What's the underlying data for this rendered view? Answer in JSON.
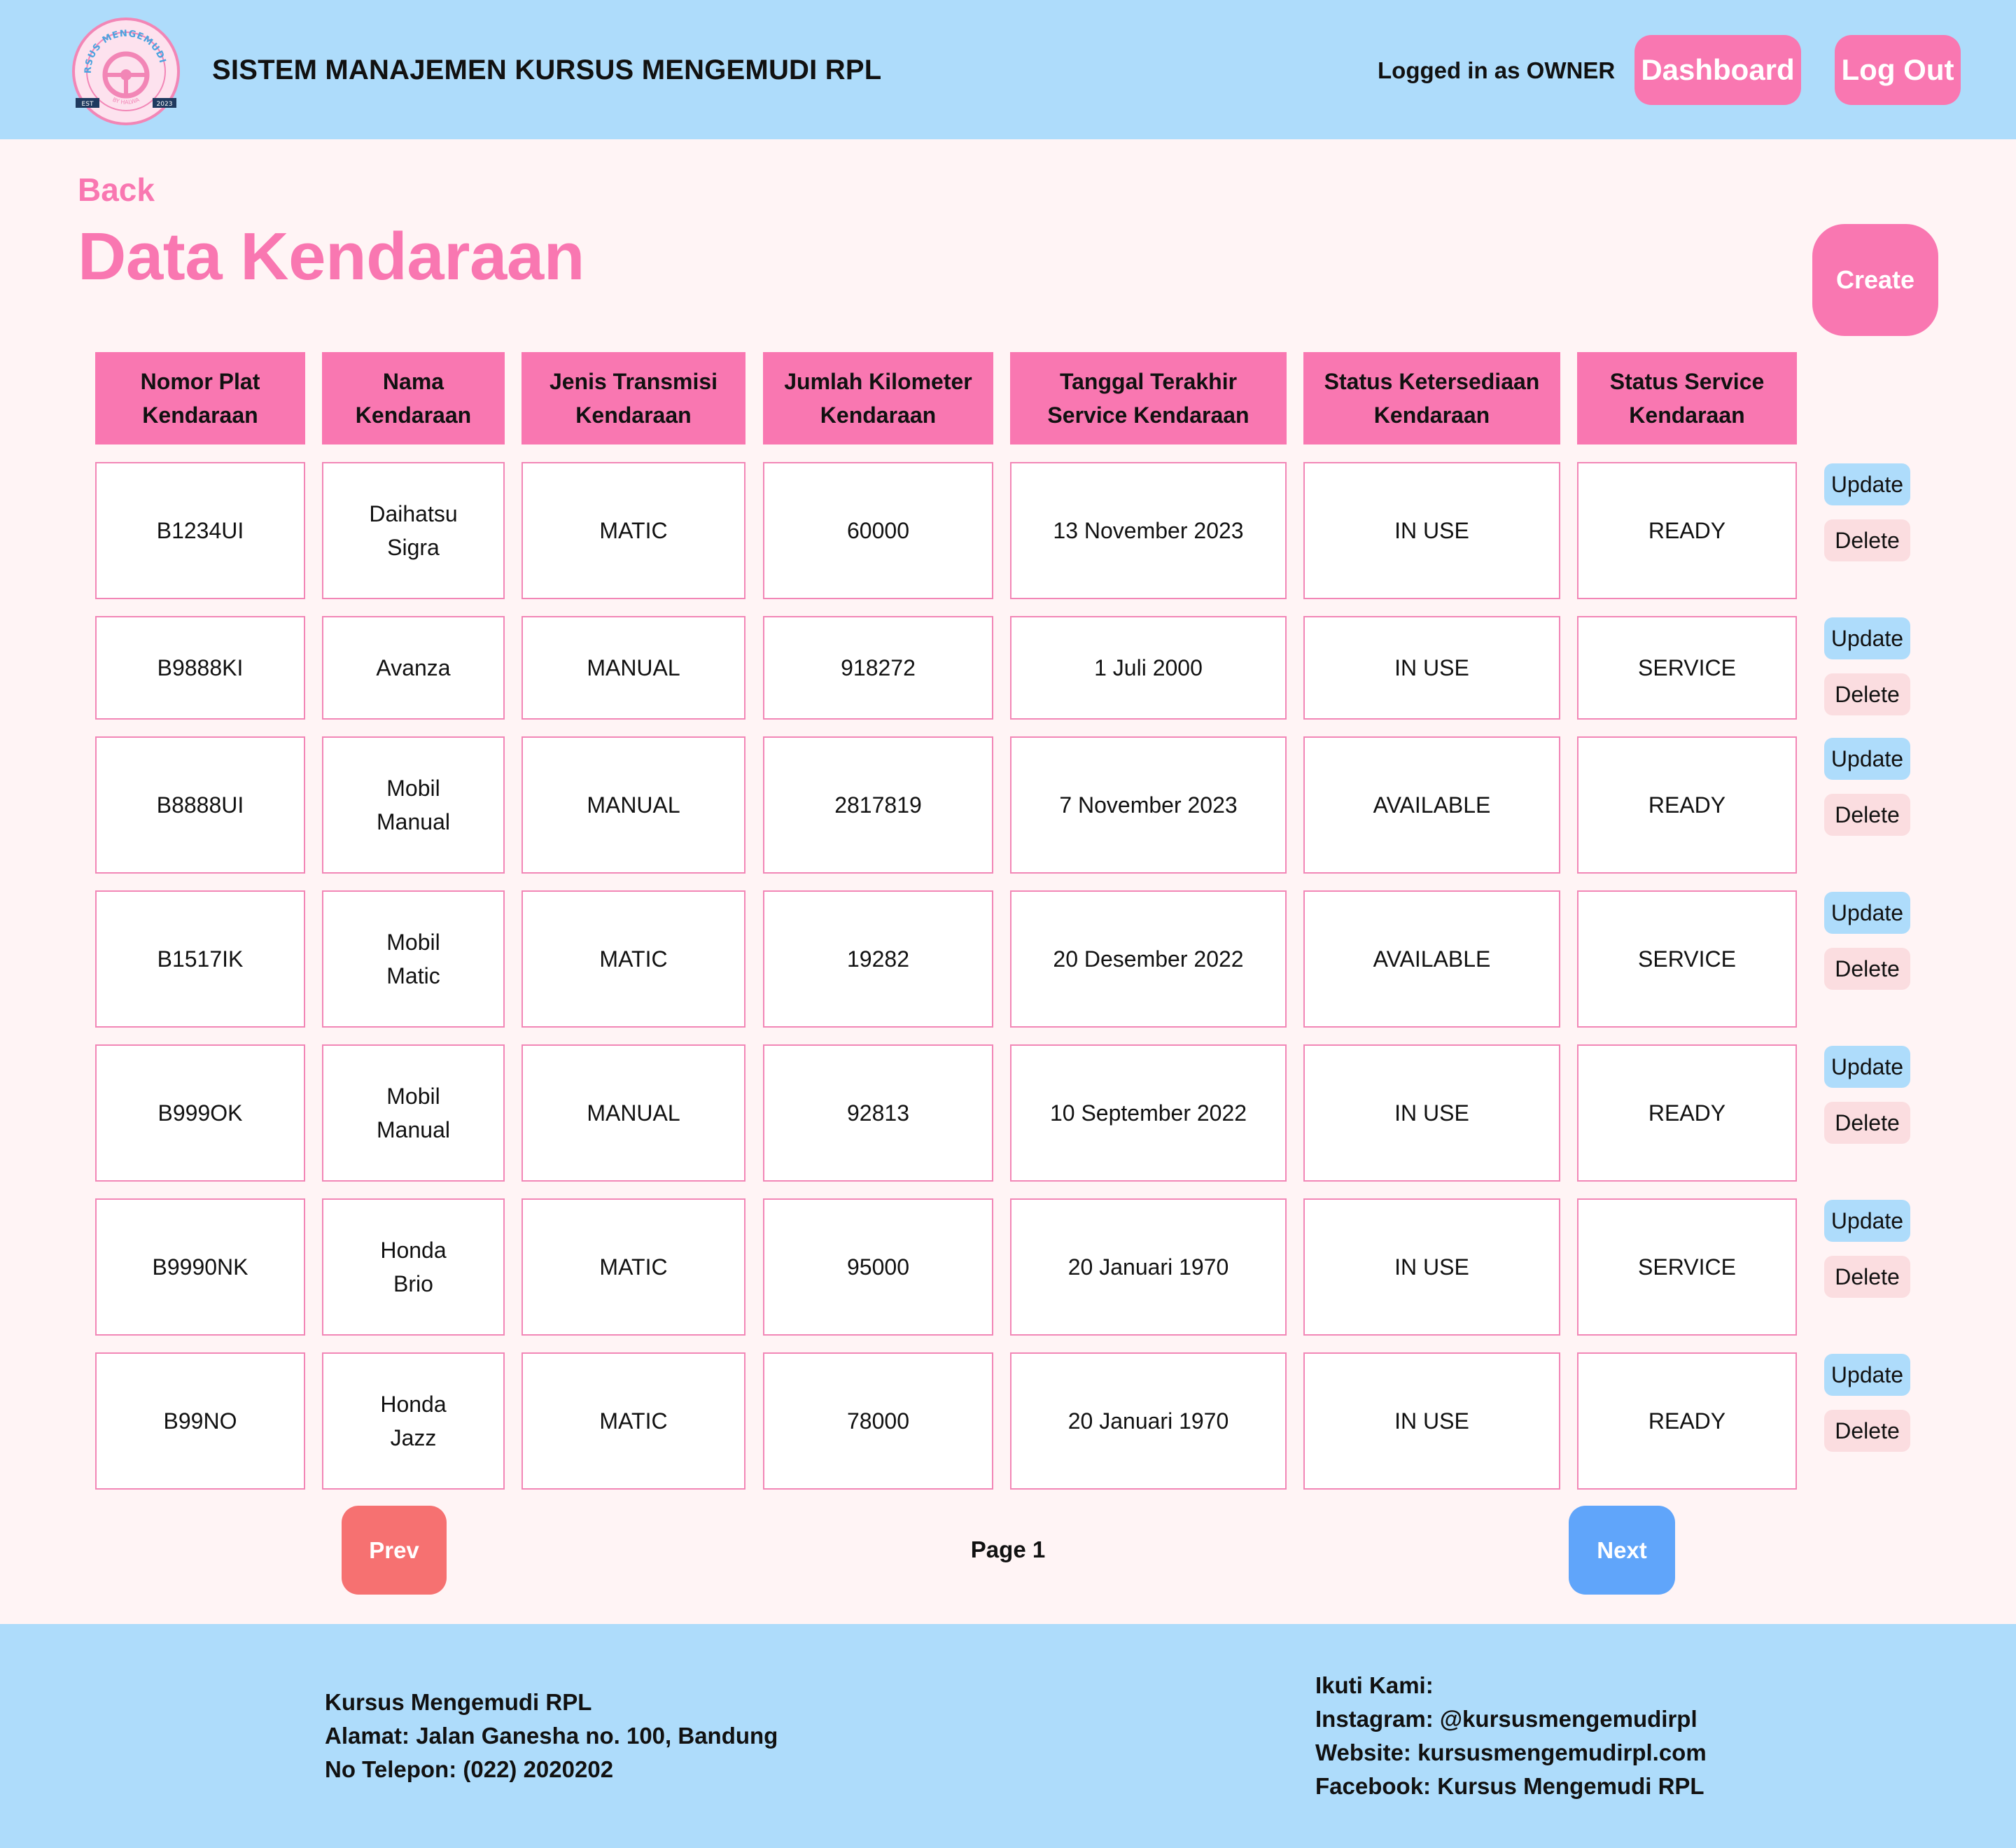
{
  "header": {
    "logo_text_top": "KURSUS MENGEMUDI RPL",
    "logo_text_bottom": "BY HALWA",
    "logo_left": "EST",
    "logo_right": "2023",
    "title": "SISTEM MANAJEMEN KURSUS MENGEMUDI RPL",
    "logged_in": "Logged in as OWNER",
    "dashboard_label": "Dashboard",
    "logout_label": "Log Out"
  },
  "main": {
    "back_label": "Back",
    "page_title": "Data Kendaraan",
    "create_label": "Create"
  },
  "table": {
    "headers": [
      "Nomor Plat\nKendaraan",
      "Nama\nKendaraan",
      "Jenis Transmisi\nKendaraan",
      "Jumlah Kilometer\nKendaraan",
      "Tanggal Terakhir\nService Kendaraan",
      "Status Ketersediaan\nKendaraan",
      "Status Service\nKendaraan"
    ],
    "rows": [
      [
        "B1234UI",
        "Daihatsu\nSigra",
        "MATIC",
        "60000",
        "13 November 2023",
        "IN USE",
        "READY"
      ],
      [
        "B9888KI",
        "Avanza",
        "MANUAL",
        "918272",
        "1 Juli 2000",
        "IN USE",
        "SERVICE"
      ],
      [
        "B8888UI",
        "Mobil\nManual",
        "MANUAL",
        "2817819",
        "7 November 2023",
        "AVAILABLE",
        "READY"
      ],
      [
        "B1517IK",
        "Mobil\nMatic",
        "MATIC",
        "19282",
        "20 Desember 2022",
        "AVAILABLE",
        "SERVICE"
      ],
      [
        "B999OK",
        "Mobil\nManual",
        "MANUAL",
        "92813",
        "10 September 2022",
        "IN USE",
        "READY"
      ],
      [
        "B9990NK",
        "Honda\nBrio",
        "MATIC",
        "95000",
        "20 Januari 1970",
        "IN USE",
        "SERVICE"
      ],
      [
        "B99NO",
        "Honda\nJazz",
        "MATIC",
        "78000",
        "20 Januari 1970",
        "IN USE",
        "READY"
      ]
    ],
    "update_label": "Update",
    "delete_label": "Delete"
  },
  "pagination": {
    "prev_label": "Prev",
    "page_label": "Page 1",
    "next_label": "Next"
  },
  "footer": {
    "company": "Kursus Mengemudi RPL",
    "address": "Alamat: Jalan Ganesha no. 100, Bandung",
    "phone": "No Telepon: (022) 2020202",
    "follow": "Ikuti Kami:",
    "instagram": "Instagram: @kursusmengemudirpl",
    "website": "Website: kursusmengemudirpl.com",
    "facebook": "Facebook: Kursus Mengemudi RPL"
  },
  "colors": {
    "header_bg": "#aedcfb",
    "accent_pink": "#f977b1",
    "page_bg": "#fff4f5",
    "prev_red": "#f67171",
    "next_blue": "#60a5fa"
  }
}
